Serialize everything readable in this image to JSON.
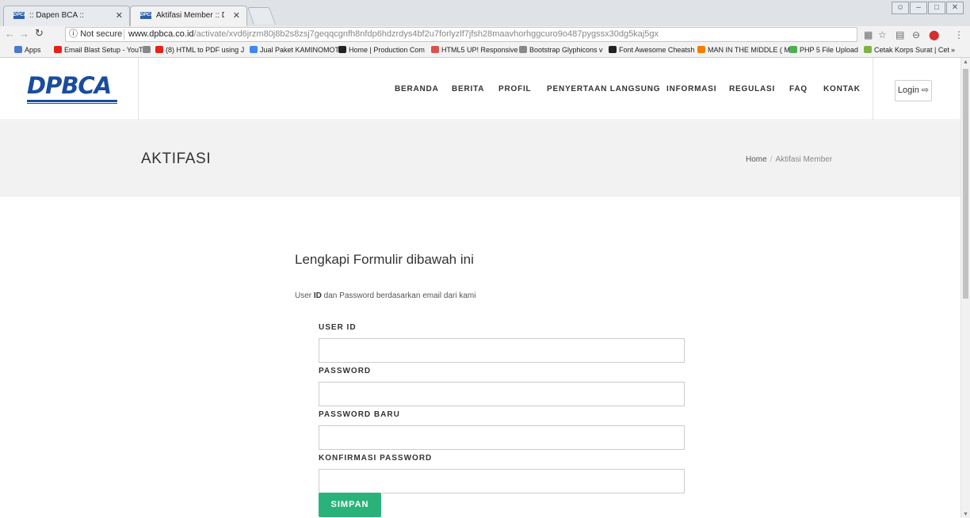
{
  "browser": {
    "tabs": [
      {
        "favicon": "DPCA",
        "title": ":: Dapen BCA ::",
        "active": false
      },
      {
        "favicon": "DPCA",
        "title": "Aktifasi Member :: Dapen B",
        "active": true
      }
    ],
    "security_label": "Not secure",
    "url_domain": "www.dpbca.co.id",
    "url_path": "/activate/xvd6jrzm80j8b2s8zsj7geqqcgnfh8nfdp6hdzrdys4bf2u7forlyzlf7jfsh28maavhorhggcuro9o487pygssx30dg5kaj5gx",
    "bookmarks": [
      {
        "label": "Apps",
        "icon": "apps-grid-icon",
        "color": "#4a7bd0"
      },
      {
        "label": "Email Blast Setup - YouT",
        "icon": "youtube-icon",
        "color": "#e62117"
      },
      {
        "label": "",
        "icon": "page-icon",
        "color": "#888888"
      },
      {
        "label": "(8) HTML to PDF using J",
        "icon": "youtube-icon",
        "color": "#e62117"
      },
      {
        "label": "Jual Paket KAMINOMOT",
        "icon": "google-icon",
        "color": "#4285f4"
      },
      {
        "label": "Home | Production Com",
        "icon": "flag-icon",
        "color": "#222222"
      },
      {
        "label": "HTML5 UP! Responsive",
        "icon": "html5-icon",
        "color": "#d9534f"
      },
      {
        "label": "Bootstrap Glyphicons v",
        "icon": "page-icon",
        "color": "#888888"
      },
      {
        "label": "Font Awesome Cheatsh",
        "icon": "flag-icon",
        "color": "#222222"
      },
      {
        "label": "MAN IN THE MIDDLE ( M",
        "icon": "blogger-icon",
        "color": "#f57d00"
      },
      {
        "label": "PHP 5 File Upload",
        "icon": "w3schools-icon",
        "color": "#4caf50"
      },
      {
        "label": "Cetak Korps Surat | Cet",
        "icon": "leaf-icon",
        "color": "#7cb342"
      }
    ],
    "more_bookmarks": "»"
  },
  "site": {
    "logo_text": "DPBCA",
    "brand_color": "#1a4c9e",
    "nav": [
      "BERANDA",
      "BERITA",
      "PROFIL",
      "PENYERTAAN LANGSUNG",
      "INFORMASI",
      "REGULASI",
      "FAQ",
      "KONTAK"
    ],
    "login_label": "Login"
  },
  "banner": {
    "title": "AKTIFASI",
    "breadcrumb_home": "Home",
    "breadcrumb_separator": "/",
    "breadcrumb_current": "Aktifasi Member"
  },
  "form": {
    "heading": "Lengkapi Formulir dibawah ini",
    "desc_prefix": "User ",
    "desc_bold": "ID",
    "desc_suffix": " dan Password berdasarkan email dari kami",
    "fields": [
      {
        "label": "USER ID",
        "value": ""
      },
      {
        "label": "PASSWORD",
        "value": ""
      },
      {
        "label": "PASSWORD BARU",
        "value": ""
      },
      {
        "label": "KONFIRMASI PASSWORD",
        "value": ""
      }
    ],
    "submit_label": "SIMPAN",
    "submit_color": "#2ab27b"
  }
}
